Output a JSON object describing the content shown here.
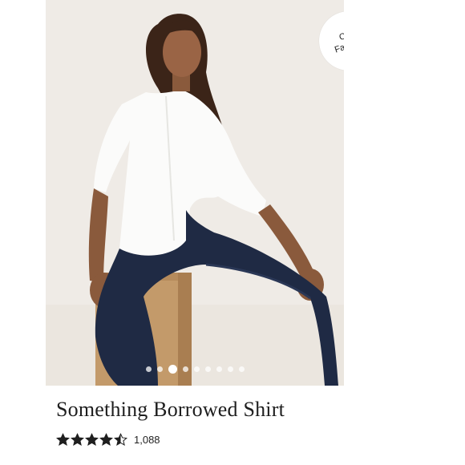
{
  "badge": {
    "line1": "Cult",
    "line2": "Favorite"
  },
  "carousel": {
    "total": 9,
    "active_index": 2
  },
  "product": {
    "title": "Something Borrowed Shirt",
    "rating": 4.5,
    "review_count": "1,088"
  },
  "colors": {
    "star": "#1f1f1f",
    "background": "#efebe6",
    "badge": "#ffffff"
  },
  "icons": {
    "star": "star-icon",
    "half_star": "half-star-icon"
  }
}
